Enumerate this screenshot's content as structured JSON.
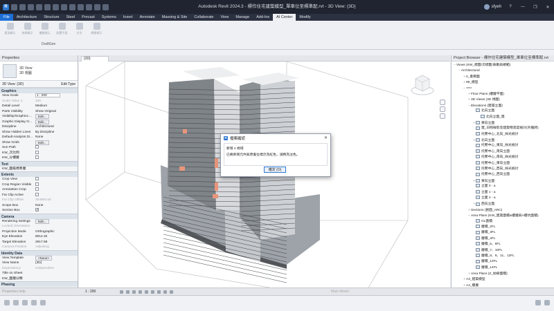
{
  "window": {
    "title": "Autodesk Revit 2024.3 - 標作住宅建築模型_單車位至標準配.rvt - 3D View: {3D}",
    "user": "sfyeh"
  },
  "ribbon": {
    "tabs": [
      "File",
      "Architecture",
      "Structure",
      "Steel",
      "Precast",
      "Systems",
      "Insert",
      "Annotate",
      "Massing & Site",
      "Collaborate",
      "View",
      "Manage",
      "Add-Ins",
      "AI Center",
      "Modify"
    ],
    "active_tab": "AI Center",
    "buttons": [
      "屋頂標示",
      "房間標示",
      "樓層標示",
      "配置平面",
      "文字",
      "網格標示"
    ],
    "panel_name": "DraftGen"
  },
  "properties": {
    "header": "Properties",
    "type_name_1": "3D View",
    "type_name_2": "3D 視圖",
    "selector": "3D View: {3D}",
    "edit_type": "Edit Type",
    "sections": {
      "graphics": "Graphics",
      "text": "Text",
      "extents": "Extents",
      "camera": "Camera",
      "identity": "Identity Data",
      "phasing": "Phasing"
    },
    "rows": {
      "view_scale": {
        "k": "View Scale",
        "v": "1 : 200"
      },
      "scale_value": {
        "k": "Scale Value 1:",
        "v": "200"
      },
      "detail_level": {
        "k": "Detail Level",
        "v": "Medium"
      },
      "parts_visibility": {
        "k": "Parts Visibility",
        "v": "Show Original"
      },
      "vis_graphics": {
        "k": "Visibility/Graphics ...",
        "v": "Edit..."
      },
      "graphic_display": {
        "k": "Graphic Display O...",
        "v": "Edit..."
      },
      "discipline": {
        "k": "Discipline",
        "v": "Architectural"
      },
      "show_hidden": {
        "k": "Show Hidden Lines",
        "v": "By Discipline"
      },
      "default_analysis": {
        "k": "Default Analysis Di...",
        "v": "None"
      },
      "show_grids": {
        "k": "Show Grids",
        "v": "Edit..."
      },
      "sun_path": {
        "k": "Sun Path",
        "v": ""
      },
      "kw_1": {
        "k": "KW_次比例",
        "v": ""
      },
      "kw_2": {
        "k": "KW_分樓層",
        "v": ""
      },
      "kw_text": {
        "k": "KW_圖紙標準層",
        "v": ""
      },
      "crop_view": {
        "k": "Crop View",
        "v": ""
      },
      "crop_region": {
        "k": "Crop Region Visible",
        "v": ""
      },
      "annotation_crop": {
        "k": "Annotation Crop",
        "v": ""
      },
      "far_clip_active": {
        "k": "Far Clip Active",
        "v": ""
      },
      "far_clip_offset": {
        "k": "Far Clip Offset",
        "v": "304800.00"
      },
      "scope_box": {
        "k": "Scope Box",
        "v": "None"
      },
      "section_box": {
        "k": "Section Box",
        "v": ""
      },
      "rendering": {
        "k": "Rendering Settings",
        "v": "Edit..."
      },
      "locked_orientation": {
        "k": "Locked Orientation",
        "v": ""
      },
      "projection_mode": {
        "k": "Projection Mode",
        "v": "Orthographic"
      },
      "eye_elevation": {
        "k": "Eye Elevation",
        "v": "8014.32"
      },
      "target_elevation": {
        "k": "Target Elevation",
        "v": "2617.58"
      },
      "camera_position": {
        "k": "Camera Position",
        "v": "Adjusting"
      },
      "view_template": {
        "k": "View Template",
        "v": "<None>"
      },
      "view_name": {
        "k": "View Name",
        "v": "{3D}"
      },
      "dependency": {
        "k": "Dependency",
        "v": "Independent"
      },
      "title_on_sheet": {
        "k": "Title on Sheet",
        "v": ""
      },
      "kw_layer": {
        "k": "KW_圖層分類",
        "v": ""
      }
    },
    "help_label": "Properties help",
    "apply_label": "Apply"
  },
  "view_tab": {
    "label": "{3D}"
  },
  "dialog": {
    "title": "檔案確認",
    "line1": "新增 4 視域",
    "line2": "已將新增元件與原書位標示為紅色，請務為注色。",
    "ok_label": "確定 (O)"
  },
  "project_browser": {
    "header": "Project Browser - 標作住宅建築模型_單車位至標準配.rvt",
    "nodes": [
      {
        "t": "Views (KW_標籤/次標籤/表數與規範)",
        "lv": 0,
        "tog": "−",
        "ic": false,
        "sel": false
      },
      {
        "t": "Architectural",
        "lv": 1,
        "tog": "−",
        "ic": false,
        "sel": false
      },
      {
        "t": "0_重要圖",
        "lv": 2,
        "tog": "+",
        "ic": false,
        "sel": false
      },
      {
        "t": "99_模型",
        "lv": 2,
        "tog": "+",
        "ic": false,
        "sel": false
      },
      {
        "t": "???",
        "lv": 2,
        "tog": "−",
        "ic": false,
        "sel": false
      },
      {
        "t": "Floor Plans (樓層平面)",
        "lv": 3,
        "tog": "+",
        "ic": false,
        "sel": false
      },
      {
        "t": "3D Views (3D 視圖)",
        "lv": 3,
        "tog": "+",
        "ic": false,
        "sel": false
      },
      {
        "t": "Elevations (建築立面)",
        "lv": 3,
        "tog": "−",
        "ic": false,
        "sel": false
      },
      {
        "t": "北向立面",
        "lv": 4,
        "tog": "",
        "ic": true,
        "sel": false
      },
      {
        "t": "北向立面_建",
        "lv": 5,
        "tog": "",
        "ic": true,
        "sel": false
      },
      {
        "t": "東向立面",
        "lv": 4,
        "tog": "+",
        "ic": true,
        "sel": false
      },
      {
        "t": "建_日照線影及建築物高度檢討(外牆牌)",
        "lv": 4,
        "tog": "",
        "ic": true,
        "sel": false
      },
      {
        "t": "托嬰中心_北向_採光檢討",
        "lv": 4,
        "tog": "",
        "ic": true,
        "sel": false
      },
      {
        "t": "北向立面",
        "lv": 4,
        "tog": "+",
        "ic": true,
        "sel": false
      },
      {
        "t": "托嬰中心_東向_採光檢討",
        "lv": 4,
        "tog": "",
        "ic": true,
        "sel": false
      },
      {
        "t": "托嬰中心_南向立面",
        "lv": 4,
        "tog": "",
        "ic": true,
        "sel": false
      },
      {
        "t": "托嬰中心_南向_採光檢討",
        "lv": 4,
        "tog": "",
        "ic": true,
        "sel": false
      },
      {
        "t": "托嬰中心_東向立面",
        "lv": 4,
        "tog": "",
        "ic": true,
        "sel": false
      },
      {
        "t": "托嬰中心_西向_採光檢討",
        "lv": 4,
        "tog": "",
        "ic": true,
        "sel": false
      },
      {
        "t": "托嬰中心_西向立面",
        "lv": 4,
        "tog": "",
        "ic": true,
        "sel": false
      },
      {
        "t": "東向立面",
        "lv": 4,
        "tog": "+",
        "ic": true,
        "sel": false
      },
      {
        "t": "立面 0 - a",
        "lv": 4,
        "tog": "",
        "ic": true,
        "sel": false
      },
      {
        "t": "立面 1 - a",
        "lv": 4,
        "tog": "",
        "ic": true,
        "sel": false
      },
      {
        "t": "立面 2 - a",
        "lv": 4,
        "tog": "",
        "ic": true,
        "sel": false
      },
      {
        "t": "西向立面",
        "lv": 4,
        "tog": "+",
        "ic": true,
        "sel": false
      },
      {
        "t": "Sections (剖面_ARC)",
        "lv": 3,
        "tog": "+",
        "ic": false,
        "sel": false
      },
      {
        "t": "Area Plans (KW_建築面積&樓層與A樓坑面積)",
        "lv": 3,
        "tog": "−",
        "ic": false,
        "sel": false
      },
      {
        "t": "GL面積",
        "lv": 4,
        "tog": "",
        "ic": true,
        "sel": false
      },
      {
        "t": "層積_2FL",
        "lv": 4,
        "tog": "",
        "ic": true,
        "sel": false
      },
      {
        "t": "層積_3FL",
        "lv": 4,
        "tog": "",
        "ic": true,
        "sel": false
      },
      {
        "t": "層積_4FL",
        "lv": 4,
        "tog": "",
        "ic": true,
        "sel": false
      },
      {
        "t": "層積_5、6FL",
        "lv": 4,
        "tog": "",
        "ic": true,
        "sel": false
      },
      {
        "t": "層積_7、10FL",
        "lv": 4,
        "tog": "",
        "ic": true,
        "sel": false
      },
      {
        "t": "層積_8、9、11、12FL",
        "lv": 4,
        "tog": "",
        "ic": true,
        "sel": false
      },
      {
        "t": "層積_13FL",
        "lv": 4,
        "tog": "",
        "ic": true,
        "sel": false
      },
      {
        "t": "層積_14FL",
        "lv": 4,
        "tog": "",
        "ic": true,
        "sel": false
      },
      {
        "t": "Area Plans (Z_妨樹面積)",
        "lv": 3,
        "tog": "+",
        "ic": false,
        "sel": false
      },
      {
        "t": "A3_建築模型",
        "lv": 2,
        "tog": "+",
        "ic": false,
        "sel": false
      },
      {
        "t": "A4_樓層",
        "lv": 2,
        "tog": "+",
        "ic": false,
        "sel": false
      }
    ]
  },
  "status": {
    "left_hint": "Properties help",
    "scale": "1 : 200",
    "main_model": "Main Model"
  },
  "colors": {
    "title_bg": "#1f2430",
    "accent": "#1d6fd6",
    "building_highlight": "#e8957a"
  }
}
